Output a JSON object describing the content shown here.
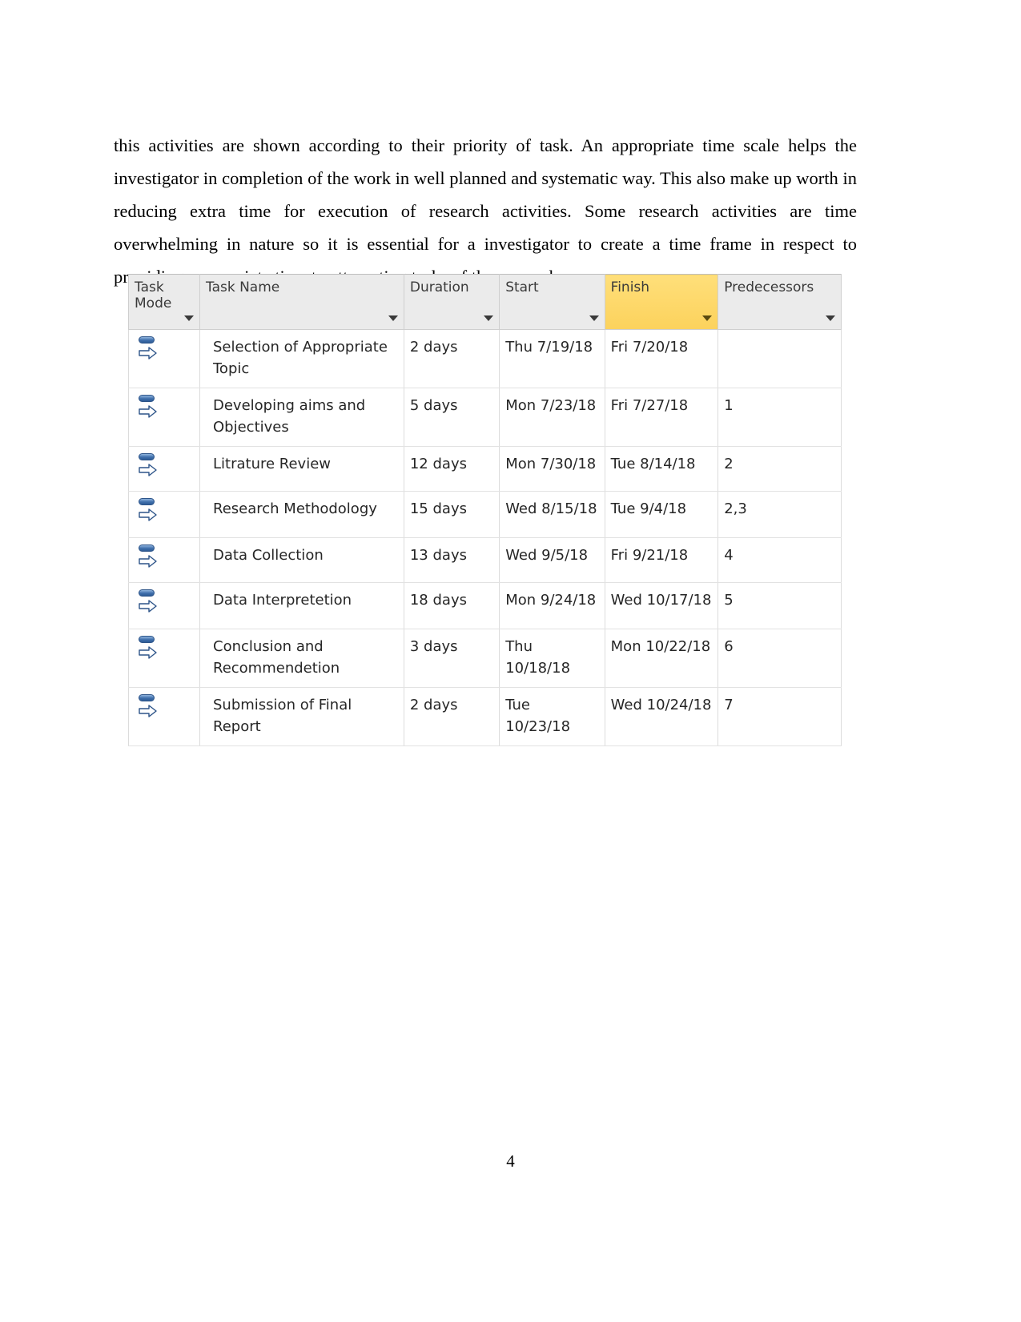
{
  "document": {
    "paragraph": "this activities are shown according to their priority of task. An appropriate time scale helps the investigator in completion of the work in well planned and systematic way. This also make up worth in reducing extra time for execution of research activities. Some research activities are time overwhelming in nature so it is essential for a investigator to create a time frame in respect to providing appropriate time to attempting tasks of the research.",
    "page_number": "4"
  },
  "gantt_table": {
    "highlight_color": "#ffd966",
    "header_bg": "#ebebeb",
    "columns": [
      {
        "key": "task_mode",
        "label": "Task Mode",
        "label_line1": "Task",
        "label_line2": "Mode",
        "highlighted": false,
        "filter_icon": "chevron-down-icon"
      },
      {
        "key": "task_name",
        "label": "Task Name",
        "highlighted": false,
        "filter_icon": "chevron-down-icon"
      },
      {
        "key": "duration",
        "label": "Duration",
        "highlighted": false,
        "filter_icon": "chevron-down-icon"
      },
      {
        "key": "start",
        "label": "Start",
        "highlighted": false,
        "filter_icon": "chevron-down-icon"
      },
      {
        "key": "finish",
        "label": "Finish",
        "highlighted": true,
        "filter_icon": "chevron-down-icon"
      },
      {
        "key": "predecessors",
        "label": "Predecessors",
        "highlighted": false,
        "filter_icon": "chevron-down-icon"
      }
    ],
    "rows": [
      {
        "mode_icon": "auto-scheduled-icon",
        "task_name": "Selection of Appropriate Topic",
        "duration": "2 days",
        "start": "Thu 7/19/18",
        "finish": "Fri 7/20/18",
        "predecessors": ""
      },
      {
        "mode_icon": "auto-scheduled-icon",
        "task_name": "Developing aims and Objectives",
        "duration": "5 days",
        "start": "Mon 7/23/18",
        "finish": "Fri 7/27/18",
        "predecessors": "1"
      },
      {
        "mode_icon": "auto-scheduled-icon",
        "task_name": "Litrature Review",
        "duration": "12 days",
        "start": "Mon 7/30/18",
        "finish": "Tue 8/14/18",
        "predecessors": "2"
      },
      {
        "mode_icon": "auto-scheduled-icon",
        "task_name": "Research Methodology",
        "duration": "15 days",
        "start": "Wed 8/15/18",
        "finish": "Tue 9/4/18",
        "predecessors": "2,3"
      },
      {
        "mode_icon": "auto-scheduled-icon",
        "task_name": "Data Collection",
        "duration": "13 days",
        "start": "Wed 9/5/18",
        "finish": "Fri 9/21/18",
        "predecessors": "4"
      },
      {
        "mode_icon": "auto-scheduled-icon",
        "task_name": "Data Interpretetion",
        "duration": "18 days",
        "start": "Mon 9/24/18",
        "finish": "Wed 10/17/18",
        "predecessors": "5"
      },
      {
        "mode_icon": "auto-scheduled-icon",
        "task_name": "Conclusion and Recommendetion",
        "duration": "3 days",
        "start": "Thu 10/18/18",
        "finish": "Mon 10/22/18",
        "predecessors": "6"
      },
      {
        "mode_icon": "auto-scheduled-icon",
        "task_name": "Submission of Final Report",
        "duration": "2 days",
        "start": "Tue 10/23/18",
        "finish": "Wed 10/24/18",
        "predecessors": "7"
      }
    ]
  }
}
